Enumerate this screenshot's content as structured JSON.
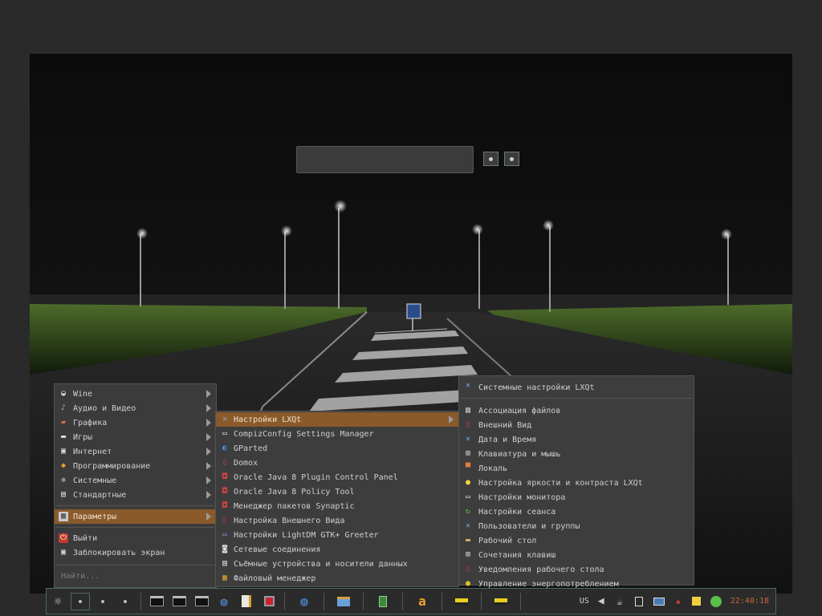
{
  "main_menu": {
    "items": [
      {
        "label": "Wine",
        "icon": "wine-glass-icon",
        "submenu": true
      },
      {
        "label": "Аудио и Видео",
        "icon": "music-note-icon",
        "submenu": true
      },
      {
        "label": "Графика",
        "icon": "paint-icon",
        "submenu": true
      },
      {
        "label": "Игры",
        "icon": "gamepad-icon",
        "submenu": true
      },
      {
        "label": "Интернет",
        "icon": "globe-icon",
        "submenu": true
      },
      {
        "label": "Программирование",
        "icon": "code-icon",
        "submenu": true
      },
      {
        "label": "Системные",
        "icon": "gear-icon",
        "submenu": true
      },
      {
        "label": "Стандартные",
        "icon": "accessories-icon",
        "submenu": true
      }
    ],
    "parameters": {
      "label": "Параметры",
      "icon": "settings-icon"
    },
    "logout": {
      "label": "Выйти",
      "icon": "power-icon"
    },
    "lock": {
      "label": "Заблокировать экран",
      "icon": "lock-icon"
    },
    "search_placeholder": "Найти..."
  },
  "sub_menu": {
    "items": [
      {
        "label": "Настройки LXQt",
        "icon": "tools-icon",
        "submenu": true,
        "active": true
      },
      {
        "label": "CompizConfig Settings Manager",
        "icon": "compiz-icon"
      },
      {
        "label": "GParted",
        "icon": "gparted-icon"
      },
      {
        "label": "Domox",
        "icon": "domox-icon"
      },
      {
        "label": "Oracle Java 8 Plugin Control Panel",
        "icon": "java-icon"
      },
      {
        "label": "Oracle Java 8 Policy Tool",
        "icon": "java-icon"
      },
      {
        "label": "Менеджер пакетов Synaptic",
        "icon": "package-icon"
      },
      {
        "label": "Настройка Внешнего Вида",
        "icon": "appearance-icon"
      },
      {
        "label": "Настройки LightDM GTK+ Greeter",
        "icon": "lightdm-icon"
      },
      {
        "label": "Сетевые соединения",
        "icon": "network-icon"
      },
      {
        "label": "Съёмные устройства и носители данных",
        "icon": "removable-media-icon"
      },
      {
        "label": "Файловый менеджер",
        "icon": "file-manager-icon"
      }
    ]
  },
  "lxqt_menu": {
    "header": {
      "label": "Системные настройки LXQt",
      "icon": "tools-icon"
    },
    "items": [
      {
        "label": "Ассоциация файлов",
        "icon": "file-association-icon"
      },
      {
        "label": "Внешний Вид",
        "icon": "appearance-icon"
      },
      {
        "label": "Дата и Время",
        "icon": "clock-tools-icon"
      },
      {
        "label": "Клавиатура и мышь",
        "icon": "keyboard-mouse-icon"
      },
      {
        "label": "Локаль",
        "icon": "locale-icon"
      },
      {
        "label": "Настройка яркости и контраста LXQt",
        "icon": "lightbulb-icon"
      },
      {
        "label": "Настройки монитора",
        "icon": "monitor-icon"
      },
      {
        "label": "Настройки сеанса",
        "icon": "session-icon"
      },
      {
        "label": "Пользователи и группы",
        "icon": "users-icon"
      },
      {
        "label": "Рабочий стол",
        "icon": "desktop-folder-icon"
      },
      {
        "label": "Сочетания клавиш",
        "icon": "shortcuts-icon"
      },
      {
        "label": "Уведомления рабочего стола",
        "icon": "notifications-icon"
      },
      {
        "label": "Управление энергопотреблением",
        "icon": "power-management-icon"
      }
    ]
  },
  "taskbar": {
    "layout": "US",
    "clock": "22:40:18"
  },
  "colors": {
    "highlight": "#8a5a2b",
    "panel_border": "#4b6a60",
    "clock": "#c06a3a"
  }
}
